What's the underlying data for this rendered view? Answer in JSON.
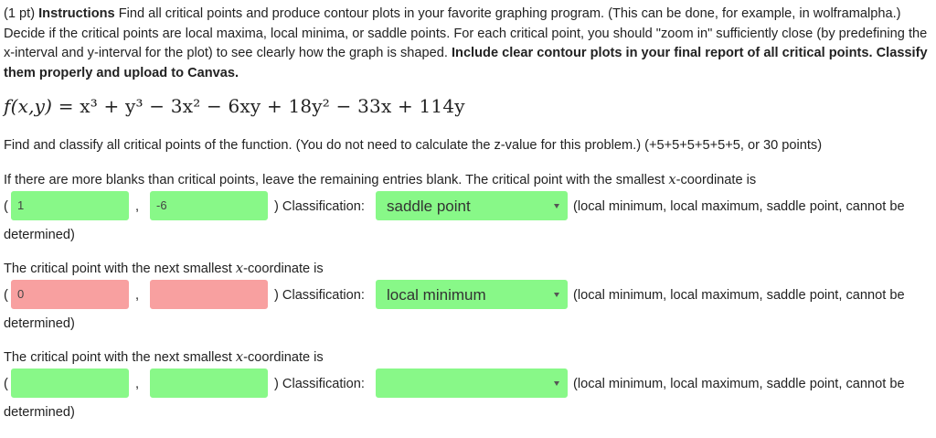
{
  "instructions": {
    "points": "(1 pt)",
    "heading": "Instructions",
    "body": "Find all critical points and produce contour plots in your favorite graphing program. (This can be done, for example, in wolframalpha.) Decide if the critical points are local maxima, local minima, or saddle points. For each critical point, you should \"zoom in\" sufficiently close (by predefining the x-interval and y-interval for the plot) to see clearly how the graph is shaped.",
    "bold_tail": "Include clear contour plots in your final report of all critical points. Classify them properly and upload to Canvas."
  },
  "function": {
    "lhs": "f(x,y)",
    "rhs": "= x³ + y³ − 3x² − 6xy + 18y² − 33x + 114y"
  },
  "task": {
    "text": "Find and classify all critical points of the function. (You do not need to calculate the z-value for this problem.) (+5+5+5+5+5+5, or 30 points)",
    "blanks_note_prefix": "If there are more blanks than critical points, leave the remaining entries blank. The critical point with the smallest ",
    "x_symbol": "x",
    "blanks_note_suffix": "-coordinate is"
  },
  "next_label": {
    "prefix": "The critical point with the next smallest ",
    "x_symbol": "x",
    "suffix": "-coordinate is"
  },
  "common": {
    "open_paren": "(",
    "comma": ",",
    "classification_label": ") Classification:",
    "options_note": "(local minimum, local maximum, saddle point, cannot be",
    "determined": "determined)"
  },
  "points": [
    {
      "x": "1",
      "x_state": "correct",
      "y": "-6",
      "y_state": "correct",
      "classification": "saddle point",
      "classification_state": "correct"
    },
    {
      "x": "0",
      "x_state": "incorrect",
      "y": "",
      "y_state": "incorrect",
      "classification": "local minimum",
      "classification_state": "correct"
    },
    {
      "x": "",
      "x_state": "correct",
      "y": "",
      "y_state": "correct",
      "classification": "",
      "classification_state": "correct"
    }
  ],
  "colors": {
    "correct_fill": "#88f888",
    "incorrect_fill": "#f8a0a0",
    "text": "#222222"
  }
}
